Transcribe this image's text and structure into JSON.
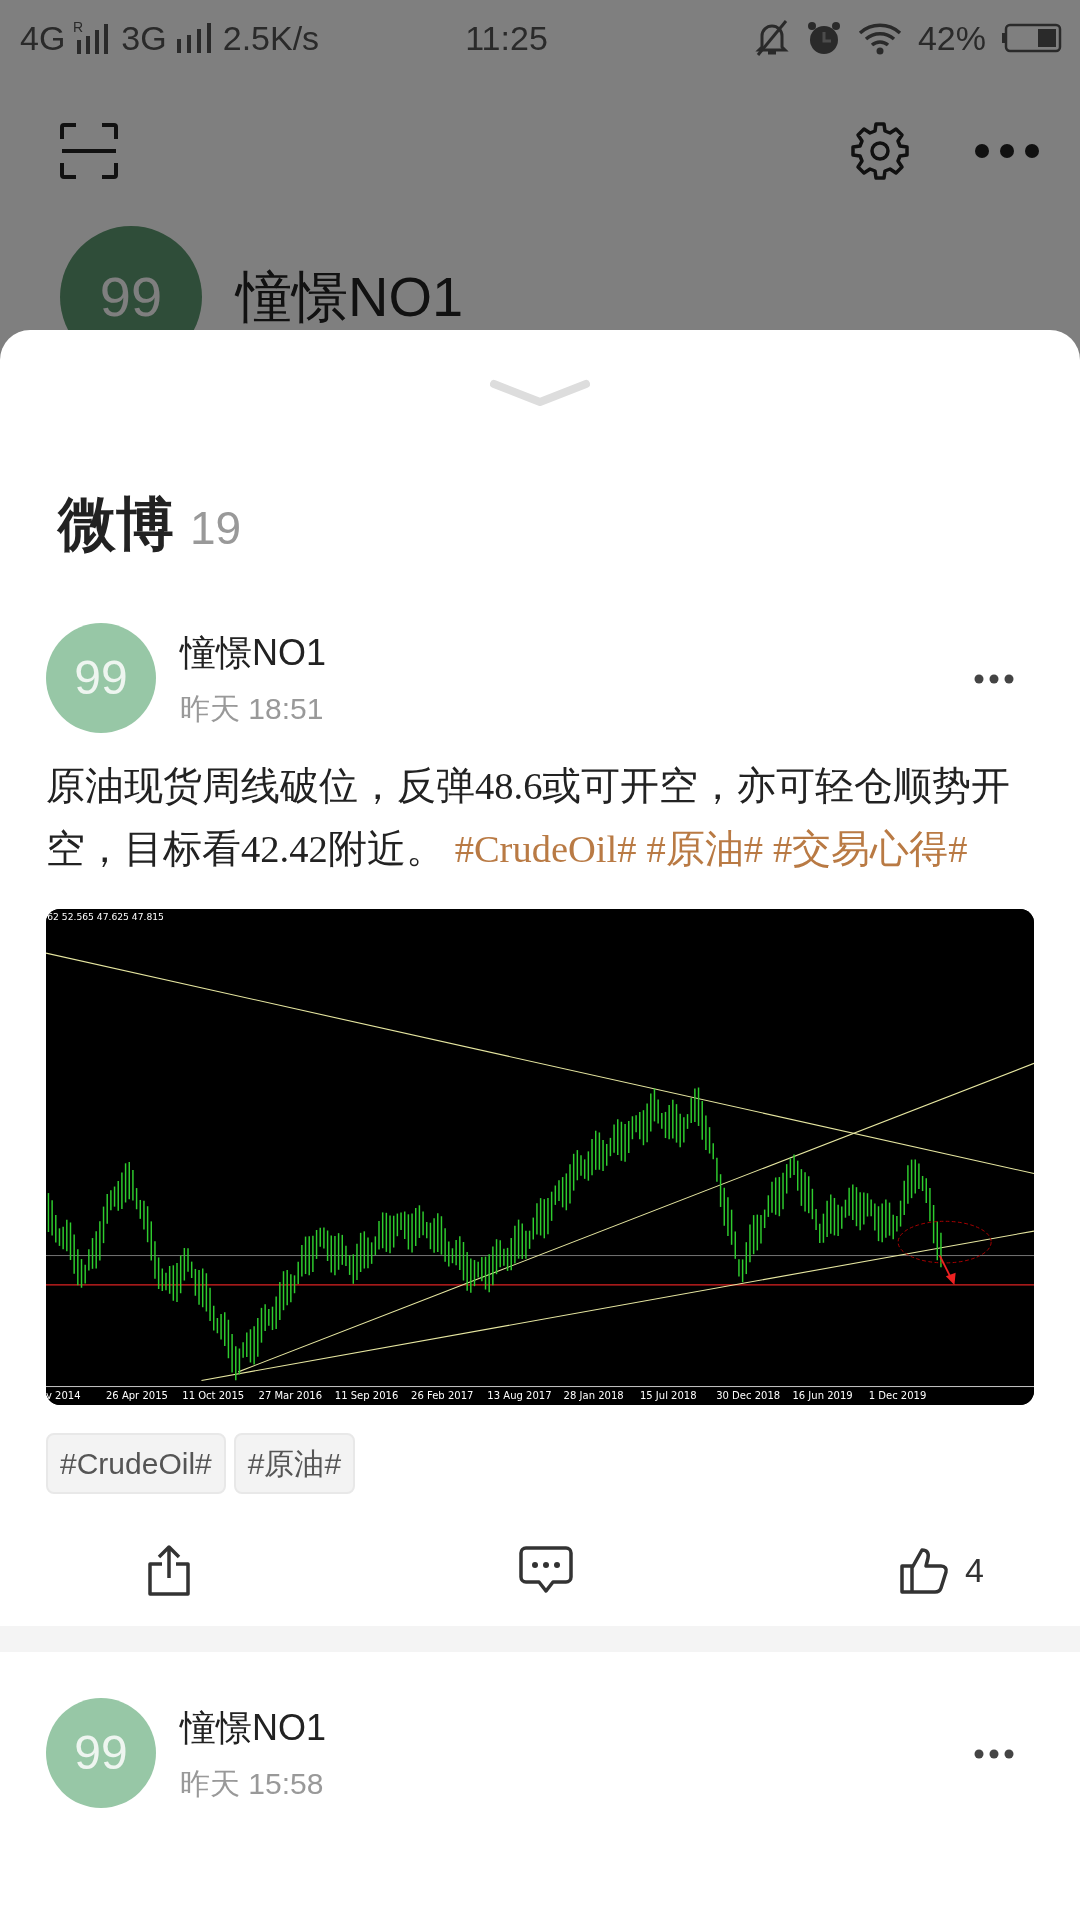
{
  "status_bar": {
    "network_1": "4G",
    "roaming": "R",
    "network_2": "3G",
    "speed": "2.5K/s",
    "time": "11:25",
    "battery": "42%"
  },
  "background_profile": {
    "avatar": "99",
    "name": "憧憬NO1"
  },
  "section": {
    "title": "微博",
    "count": "19"
  },
  "posts": [
    {
      "avatar": "99",
      "author": "憧憬NO1",
      "time": "昨天 18:51",
      "text_parts": [
        {
          "kind": "text",
          "text": "原油现货周线破位，反弹48.6或可开空，亦可轻仓顺势开空，目标看42.42附近。"
        },
        {
          "kind": "topic",
          "text": "#CrudeOil#"
        },
        {
          "kind": "topic",
          "text": "#原油#"
        },
        {
          "kind": "topic",
          "text": "#交易心得#"
        }
      ],
      "chart_image": {
        "header": "62 52.565 47.625 47.815",
        "x_labels": [
          "v 2014",
          "26 Apr 2015",
          "11 Oct 2015",
          "27 Mar 2016",
          "11 Sep 2016",
          "26 Feb 2017",
          "13 Aug 2017",
          "28 Jan 2018",
          "15 Jul 2018",
          "30 Dec 2018",
          "16 Jun 2019",
          "1 Dec 2019"
        ]
      },
      "tags": [
        "#CrudeOil#",
        "#原油#"
      ],
      "likes": "4"
    },
    {
      "avatar": "99",
      "author": "憧憬NO1",
      "time": "昨天 15:58"
    }
  ]
}
